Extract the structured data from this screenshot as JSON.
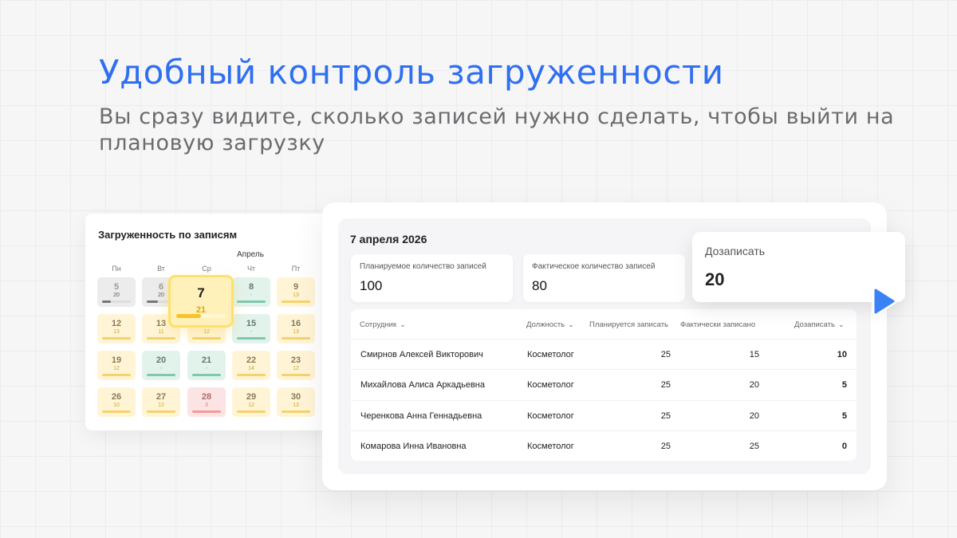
{
  "hero": {
    "title": "Удобный контроль загруженности",
    "subtitle": "Вы сразу видите, сколько записей нужно сделать, чтобы выйти на плановую загрузку"
  },
  "calendar": {
    "title": "Загруженность по записям",
    "month": "Апрель",
    "weekdays": [
      "Пн",
      "Вт",
      "Ср",
      "Чт",
      "Пт"
    ],
    "weeks": [
      [
        {
          "day": "5",
          "count": "20",
          "status": "gray",
          "fill": 0.3
        },
        {
          "day": "6",
          "count": "20",
          "status": "gray",
          "fill": 0.4
        },
        {
          "day": "7",
          "count": "21",
          "status": "selected",
          "fill": 0.5
        },
        {
          "day": "8",
          "count": "-",
          "status": "green",
          "fill": 1.0
        },
        {
          "day": "9",
          "count": "13",
          "status": "yellow",
          "fill": 1.0
        }
      ],
      [
        {
          "day": "12",
          "count": "13",
          "status": "yellow",
          "fill": 1.0
        },
        {
          "day": "13",
          "count": "11",
          "status": "yellow",
          "fill": 1.0
        },
        {
          "day": "14",
          "count": "12",
          "status": "yellow",
          "fill": 1.0
        },
        {
          "day": "15",
          "count": "-",
          "status": "green",
          "fill": 1.0
        },
        {
          "day": "16",
          "count": "13",
          "status": "yellow",
          "fill": 1.0
        }
      ],
      [
        {
          "day": "19",
          "count": "12",
          "status": "yellow",
          "fill": 1.0
        },
        {
          "day": "20",
          "count": "-",
          "status": "green",
          "fill": 1.0
        },
        {
          "day": "21",
          "count": "-",
          "status": "green",
          "fill": 1.0
        },
        {
          "day": "22",
          "count": "14",
          "status": "yellow",
          "fill": 1.0
        },
        {
          "day": "23",
          "count": "12",
          "status": "yellow",
          "fill": 1.0
        }
      ],
      [
        {
          "day": "26",
          "count": "10",
          "status": "yellow",
          "fill": 1.0
        },
        {
          "day": "27",
          "count": "12",
          "status": "yellow",
          "fill": 1.0
        },
        {
          "day": "28",
          "count": "3",
          "status": "red",
          "fill": 1.0
        },
        {
          "day": "29",
          "count": "12",
          "status": "yellow",
          "fill": 1.0
        },
        {
          "day": "30",
          "count": "13",
          "status": "yellow",
          "fill": 1.0
        }
      ]
    ]
  },
  "panel": {
    "date": "7 апреля 2026",
    "stats": [
      {
        "label": "Планируемое количество записей",
        "value": "100"
      },
      {
        "label": "Фактическое количество записей",
        "value": "80"
      }
    ],
    "highlight": {
      "label": "Дозаписать",
      "value": "20"
    },
    "cursor_color": "#3b82f6",
    "table": {
      "headers": {
        "employee": "Сотрудник",
        "position": "Должность",
        "planned": "Планируется записать",
        "actual": "Фактически записано",
        "remaining": "Дозаписать"
      },
      "rows": [
        {
          "name": "Смирнов Алексей Викторович",
          "position": "Косметолог",
          "planned": "25",
          "actual": "15",
          "remaining": "10"
        },
        {
          "name": "Михайлова Алиса Аркадьевна",
          "position": "Косметолог",
          "planned": "25",
          "actual": "20",
          "remaining": "5"
        },
        {
          "name": "Черенкова Анна Геннадьевна",
          "position": "Косметолог",
          "planned": "25",
          "actual": "20",
          "remaining": "5"
        },
        {
          "name": "Комарова Инна Ивановна",
          "position": "Косметолог",
          "planned": "25",
          "actual": "25",
          "remaining": "0"
        }
      ]
    }
  },
  "colors": {
    "accent": "#2f6ff0",
    "highlight_day": "#ffe06a"
  }
}
